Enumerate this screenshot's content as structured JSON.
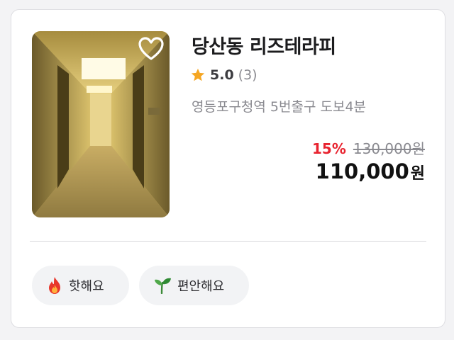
{
  "listing": {
    "title": "당산동 리즈테라피",
    "rating": "5.0",
    "review_count": "(3)",
    "location": "영등포구청역 5번출구 도보4분",
    "discount": "15%",
    "original_price": "130,000원",
    "price": "110,000",
    "currency": "원",
    "favorited": false
  },
  "tags": [
    {
      "label": "핫해요",
      "icon": "fire-icon"
    },
    {
      "label": "편안해요",
      "icon": "leaf-icon"
    }
  ],
  "colors": {
    "discount": "#e8232f",
    "star": "#f5a623",
    "chip_bg": "#f2f3f5"
  }
}
